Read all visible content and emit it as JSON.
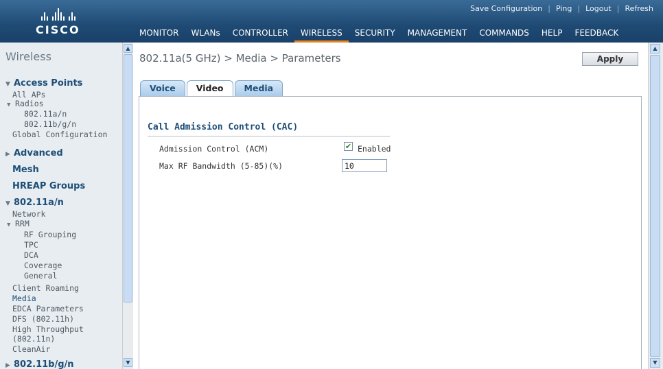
{
  "header": {
    "brand": "CISCO",
    "top_links": [
      "Save Configuration",
      "Ping",
      "Logout",
      "Refresh"
    ],
    "nav": [
      "MONITOR",
      "WLANs",
      "CONTROLLER",
      "WIRELESS",
      "SECURITY",
      "MANAGEMENT",
      "COMMANDS",
      "HELP",
      "FEEDBACK"
    ],
    "active_nav": "WIRELESS",
    "accent_color": "#e8851e"
  },
  "sidebar": {
    "title": "Wireless",
    "items": [
      {
        "label": "Access Points",
        "kind": "header",
        "expanded": true
      },
      {
        "label": "All APs",
        "kind": "item",
        "level": 1
      },
      {
        "label": "Radios",
        "kind": "item",
        "level": 1,
        "expanded": true
      },
      {
        "label": "802.11a/n",
        "kind": "item",
        "level": 2
      },
      {
        "label": "802.11b/g/n",
        "kind": "item",
        "level": 2
      },
      {
        "label": "Global Configuration",
        "kind": "item",
        "level": 1
      },
      {
        "label": "Advanced",
        "kind": "header",
        "expanded": false
      },
      {
        "label": "Mesh",
        "kind": "header"
      },
      {
        "label": "HREAP Groups",
        "kind": "header"
      },
      {
        "label": "802.11a/n",
        "kind": "header",
        "expanded": true
      },
      {
        "label": "Network",
        "kind": "item",
        "level": 1
      },
      {
        "label": "RRM",
        "kind": "item",
        "level": 1,
        "expanded": true
      },
      {
        "label": "RF Grouping",
        "kind": "item",
        "level": 2
      },
      {
        "label": "TPC",
        "kind": "item",
        "level": 2
      },
      {
        "label": "DCA",
        "kind": "item",
        "level": 2
      },
      {
        "label": "Coverage",
        "kind": "item",
        "level": 2
      },
      {
        "label": "General",
        "kind": "item",
        "level": 2
      },
      {
        "label": "Client Roaming",
        "kind": "item",
        "level": 1
      },
      {
        "label": "Media",
        "kind": "item",
        "level": 1,
        "active": true
      },
      {
        "label": "EDCA Parameters",
        "kind": "item",
        "level": 1
      },
      {
        "label": "DFS (802.11h)",
        "kind": "item",
        "level": 1
      },
      {
        "label": "High Throughput",
        "kind": "item",
        "level": 1
      },
      {
        "label": "(802.11n)",
        "kind": "item",
        "level": 1
      },
      {
        "label": "CleanAir",
        "kind": "item",
        "level": 1
      },
      {
        "label": "802.11b/g/n",
        "kind": "header",
        "expanded": false
      }
    ]
  },
  "main": {
    "page_title": "802.11a(5 GHz) > Media > Parameters",
    "apply_label": "Apply",
    "tabs": [
      "Voice",
      "Video",
      "Media"
    ],
    "active_tab": "Video",
    "section_title": "Call Admission Control (CAC)",
    "admission_control_label": "Admission Control (ACM)",
    "admission_control_checked": true,
    "enabled_label": "Enabled",
    "max_rf_label": "Max RF Bandwidth (5-85)(%)",
    "max_rf_value": "10"
  }
}
